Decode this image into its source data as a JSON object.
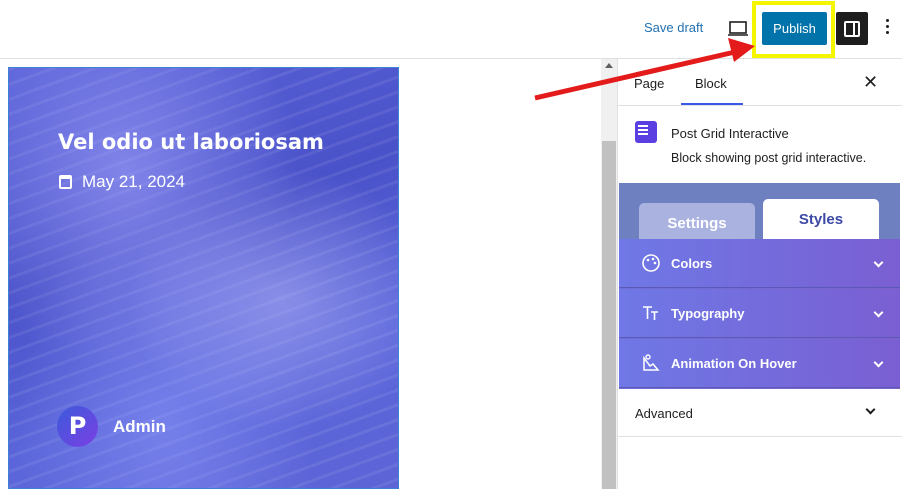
{
  "toolbar": {
    "save_draft_label": "Save draft",
    "preview_icon": "laptop-icon",
    "publish_label": "Publish",
    "settings_icon": "sidebar-toggle-icon",
    "options_icon": "kebab-menu-icon"
  },
  "post_card": {
    "title": "Vel odio ut laboriosam",
    "date": "May 21, 2024",
    "author_initial": "P",
    "author_name": "Admin"
  },
  "sidebar": {
    "tabs": [
      {
        "label": "Page"
      },
      {
        "label": "Block",
        "active": true
      }
    ],
    "block": {
      "name": "Post Grid Interactive",
      "description": "Block showing post grid interactive."
    },
    "panel_tabs": [
      {
        "label": "Settings"
      },
      {
        "label": "Styles",
        "active": true
      }
    ],
    "accordions": [
      {
        "label": "Colors",
        "icon": "palette-icon"
      },
      {
        "label": "Typography",
        "icon": "typography-icon"
      },
      {
        "label": "Animation On Hover",
        "icon": "animation-icon"
      }
    ],
    "advanced_label": "Advanced"
  },
  "colors": {
    "publish_bg": "#0073aa",
    "highlight_box": "#f5f500",
    "annotation_arrow": "#e31b1b",
    "tab_accent": "#3858e9"
  }
}
